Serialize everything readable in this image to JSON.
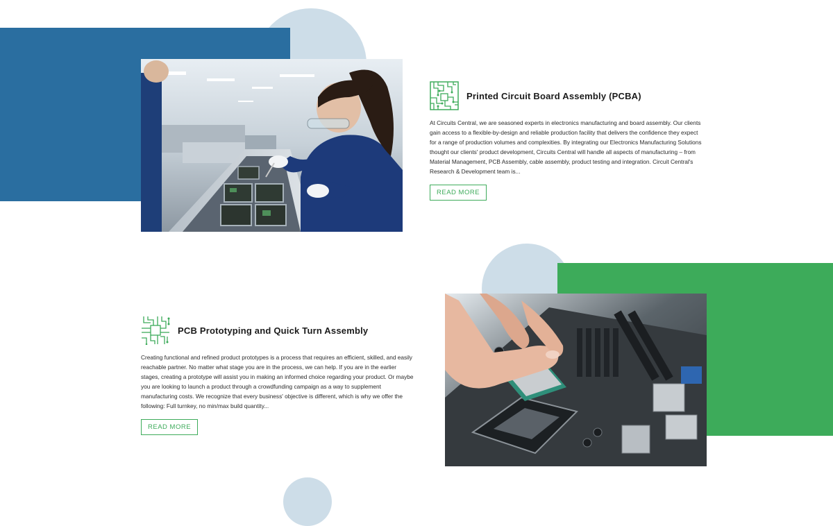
{
  "sections": [
    {
      "title": "Printed Circuit Board Assembly (PCBA)",
      "icon": "circuit-board-icon",
      "body": "At Circuits Central, we are seasoned experts in electronics manufacturing and board assembly. Our clients gain access to a flexible-by-design and reliable production facility that delivers the confidence they expect for a range of production volumes and complexities. By integrating our Electronics Manufacturing Solutions thought our clients' product development, Circuits Central will handle all aspects of manufacturing – from Material Management, PCB Assembly, cable assembly, product testing and integration. Circuit Central's Research & Development team is...",
      "button_label": "READ MORE"
    },
    {
      "title": "PCB Prototyping and Quick Turn Assembly",
      "icon": "circuit-chip-icon",
      "body": "Creating functional and refined product prototypes is a process that requires an efficient, skilled, and easily reachable partner. No matter what stage you are in the process, we can help. If you are in the earlier stages, creating a prototype will assist you in making an informed choice regarding your product. Or maybe you are looking to launch a product through a crowdfunding campaign as a way to supplement manufacturing costs. We recognize that every business' objective is different, which is why we offer the following: Full turnkey, no min/max build quantity...",
      "button_label": "READ MORE"
    }
  ],
  "colors": {
    "accent_green": "#3dab5a",
    "primary_blue": "#2a6ea0",
    "circle_light_blue": "#cddde8"
  }
}
